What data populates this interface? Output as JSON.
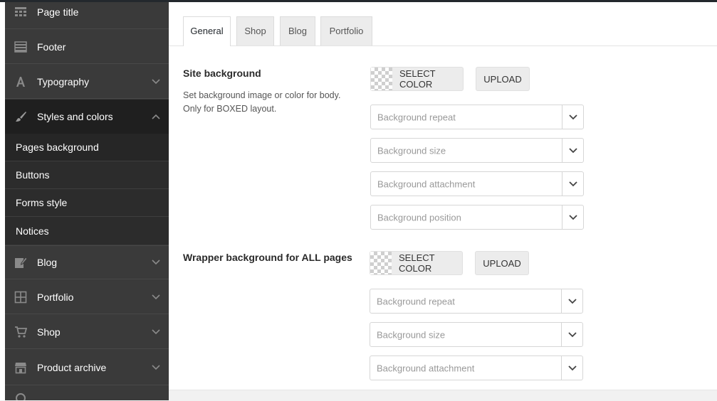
{
  "sidebar": {
    "items": [
      {
        "label": "Page title",
        "icon": "table-icon"
      },
      {
        "label": "Footer",
        "icon": "footer-icon"
      },
      {
        "label": "Typography",
        "icon": "typography-icon"
      },
      {
        "label": "Styles and colors",
        "icon": "brush-icon"
      },
      {
        "label": "Blog",
        "icon": "edit-icon"
      },
      {
        "label": "Portfolio",
        "icon": "grid-icon"
      },
      {
        "label": "Shop",
        "icon": "cart-icon"
      },
      {
        "label": "Product archive",
        "icon": "store-icon"
      }
    ],
    "subitems": [
      {
        "label": "Pages background"
      },
      {
        "label": "Buttons"
      },
      {
        "label": "Forms style"
      },
      {
        "label": "Notices"
      }
    ]
  },
  "tabs": [
    {
      "label": "General"
    },
    {
      "label": "Shop"
    },
    {
      "label": "Blog"
    },
    {
      "label": "Portfolio"
    }
  ],
  "sections": {
    "site": {
      "title": "Site background",
      "description": "Set background image or color for body. Only for BOXED layout.",
      "select_color": "SELECT COLOR",
      "upload": "UPLOAD",
      "selects": [
        "Background repeat",
        "Background size",
        "Background attachment",
        "Background position"
      ]
    },
    "wrapper": {
      "title": "Wrapper background for ALL pages",
      "select_color": "SELECT COLOR",
      "upload": "UPLOAD",
      "selects": [
        "Background repeat",
        "Background size",
        "Background attachment"
      ]
    }
  },
  "colors": {
    "sidebar_bg": "#3a3a3a",
    "sidebar_active": "#1f1f1f",
    "submenu_bg": "#2c2c2c",
    "topbar": "#23282d"
  }
}
